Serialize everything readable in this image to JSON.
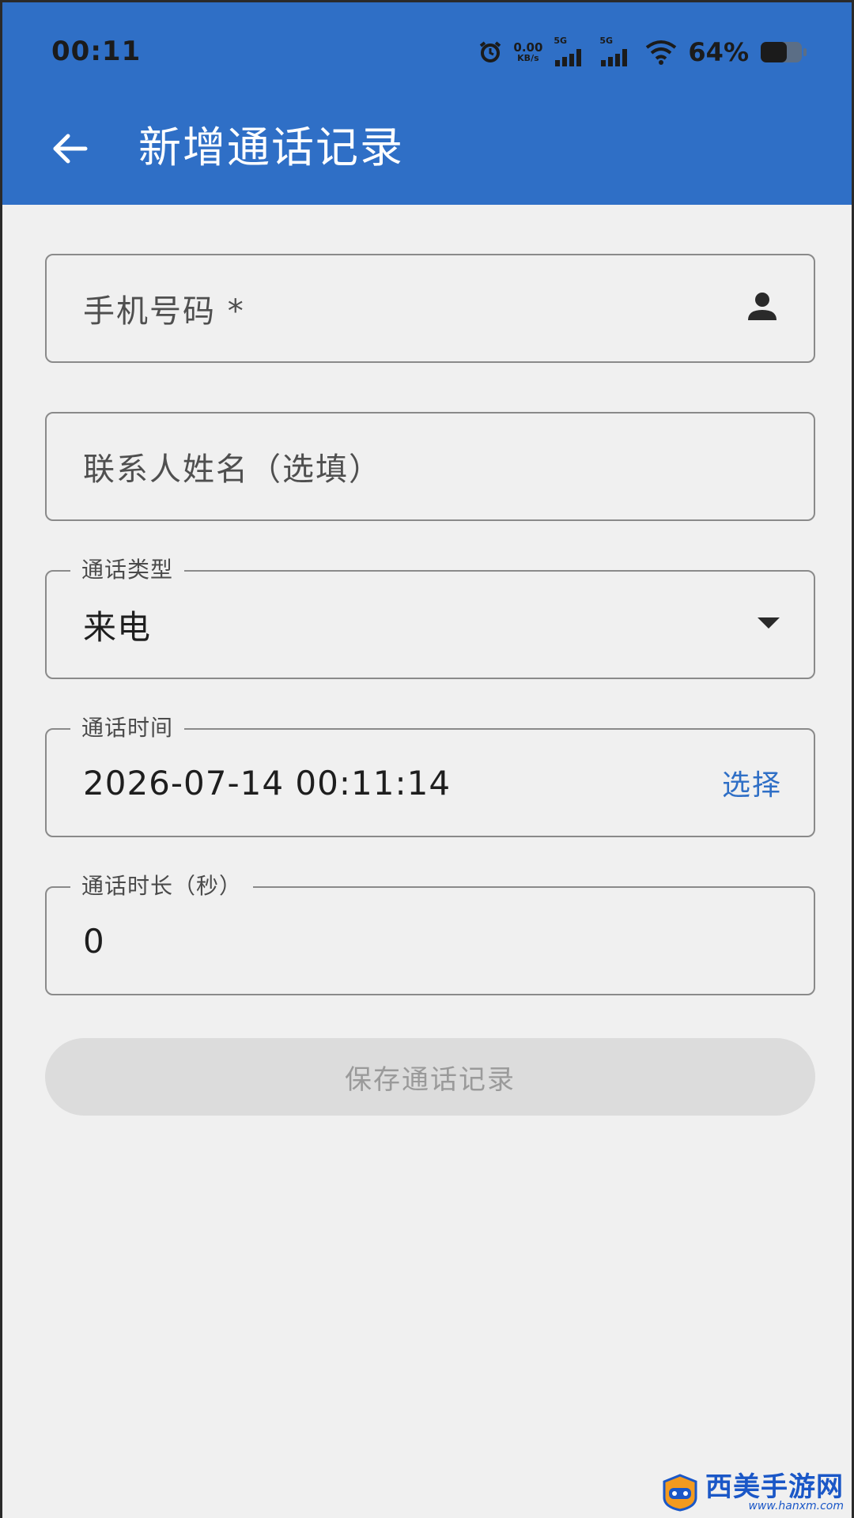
{
  "status_bar": {
    "time": "00:11",
    "net_speed_value": "0.00",
    "net_speed_unit": "KB/s",
    "sim1_tag": "5G",
    "sim2_tag": "5G",
    "battery_percent": "64%",
    "battery_level": 0.64
  },
  "app_bar": {
    "title": "新增通话记录",
    "back_icon": "arrow-back-icon"
  },
  "form": {
    "phone": {
      "placeholder": "手机号码 *",
      "trailing_icon": "person-icon"
    },
    "contact_name": {
      "placeholder": "联系人姓名（选填）"
    },
    "call_type": {
      "label": "通话类型",
      "value": "来电",
      "trailing_icon": "dropdown-arrow-icon"
    },
    "call_time": {
      "label": "通话时间",
      "value": "2026-07-14 00:11:14",
      "action": "选择"
    },
    "call_duration": {
      "label": "通话时长（秒）",
      "value": "0"
    }
  },
  "save_button": {
    "label": "保存通话记录",
    "enabled": false
  },
  "watermark": {
    "title": "西美手游网",
    "url": "www.hanxm.com"
  },
  "colors": {
    "primary": "#2f6fc6",
    "background": "#f0f0f0",
    "border": "#8a8a8a",
    "disabled_button": "#dcdcdc"
  }
}
